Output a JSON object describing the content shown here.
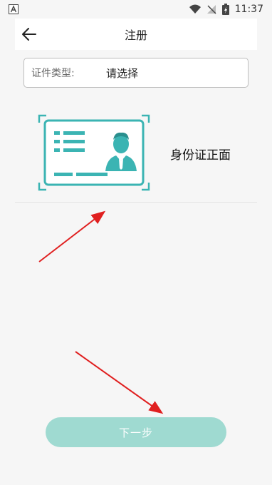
{
  "status_bar": {
    "time": "11:37"
  },
  "header": {
    "title": "注册"
  },
  "form": {
    "id_type_label": "证件类型:",
    "id_type_value": "请选择"
  },
  "card": {
    "label": "身份证正面"
  },
  "footer": {
    "next_label": "下一步"
  },
  "icons": {
    "back": "back-arrow-icon",
    "card": "id-card-front-icon",
    "wifi": "wifi-icon",
    "signal": "signal-off-icon",
    "battery": "battery-charging-icon",
    "notification": "a-notification-icon"
  },
  "colors": {
    "accent": "#3bb4b3",
    "button": "#9fdad1",
    "arrow": "#e02020"
  }
}
